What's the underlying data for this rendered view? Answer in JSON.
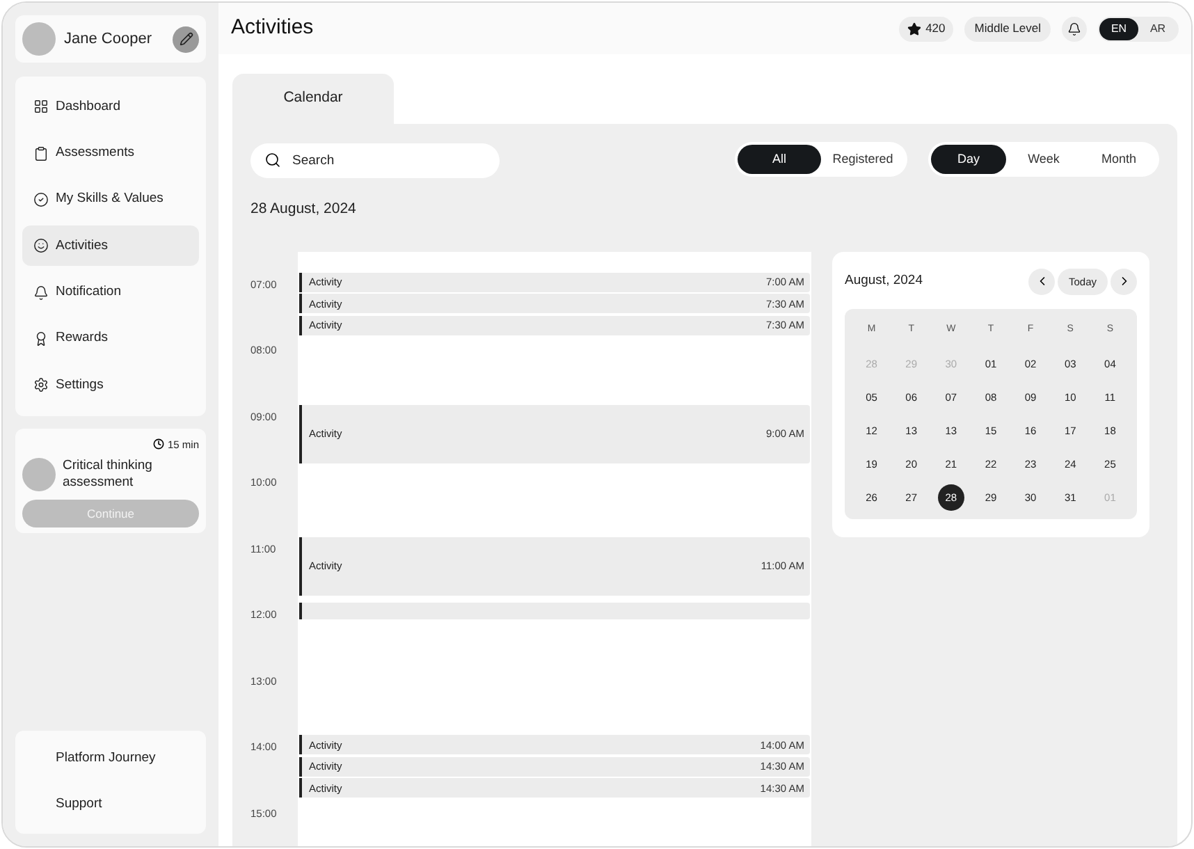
{
  "user": {
    "name": "Jane Cooper"
  },
  "nav": [
    {
      "label": "Dashboard",
      "selected": false
    },
    {
      "label": "Assessments",
      "selected": false
    },
    {
      "label": "My Skills & Values",
      "selected": false
    },
    {
      "label": "Activities",
      "selected": true
    },
    {
      "label": "Notification",
      "selected": false
    },
    {
      "label": "Rewards",
      "selected": false
    },
    {
      "label": "Settings",
      "selected": false
    }
  ],
  "assessment_card": {
    "duration": "15 min",
    "title": "Critical thinking assessment",
    "button": "Continue",
    "disabled": true
  },
  "bottom_links": [
    "Platform Journey",
    "Support"
  ],
  "header": {
    "title": "Activities",
    "points": "420",
    "level": "Middle Level",
    "languages": [
      {
        "label": "EN",
        "selected": true
      },
      {
        "label": "AR",
        "selected": false
      }
    ]
  },
  "tabs": [
    {
      "label": "Calendar",
      "selected": true
    }
  ],
  "search": {
    "placeholder": "Search"
  },
  "filters": [
    {
      "label": "All",
      "selected": true
    },
    {
      "label": "Registered",
      "selected": false
    }
  ],
  "views": [
    {
      "label": "Day",
      "selected": true
    },
    {
      "label": "Week",
      "selected": false
    },
    {
      "label": "Month",
      "selected": false
    }
  ],
  "date": "28 August, 2024",
  "timeline": [
    {
      "hour": "07:00",
      "events": [
        {
          "kind": "short",
          "label": "Activity",
          "time": "7:00 AM"
        },
        {
          "kind": "short",
          "label": "Activity",
          "time": "7:30 AM"
        },
        {
          "kind": "short",
          "label": "Activity",
          "time": "7:30 AM"
        }
      ]
    },
    {
      "hour": "08:00"
    },
    {
      "hour": "09:00",
      "events": [
        {
          "kind": "long",
          "label": "Activity",
          "time": "9:00 AM"
        }
      ]
    },
    {
      "hour": "10:00"
    },
    {
      "hour": "11:00",
      "events": [
        {
          "kind": "long",
          "label": "Activity",
          "time": "11:00 AM"
        }
      ]
    },
    {
      "hour": "12:00",
      "events": [
        {
          "kind": "bar"
        }
      ]
    },
    {
      "hour": "13:00"
    },
    {
      "hour": "14:00",
      "events": [
        {
          "kind": "short",
          "label": "Activity",
          "time": "14:00 AM"
        },
        {
          "kind": "short",
          "label": "Activity",
          "time": "14:30 AM"
        },
        {
          "kind": "short",
          "label": "Activity",
          "time": "14:30 AM"
        }
      ]
    },
    {
      "hour": "15:00"
    }
  ],
  "mini_calendar": {
    "title": "August, 2024",
    "today": "Today",
    "weekdays": [
      "M",
      "T",
      "W",
      "T",
      "F",
      "S",
      "S"
    ],
    "days": [
      {
        "label": "28",
        "outside": true,
        "selected": false
      },
      {
        "label": "29",
        "outside": true,
        "selected": false
      },
      {
        "label": "30",
        "outside": true,
        "selected": false
      },
      {
        "label": "01",
        "outside": false,
        "selected": false
      },
      {
        "label": "02",
        "outside": false,
        "selected": false
      },
      {
        "label": "03",
        "outside": false,
        "selected": false
      },
      {
        "label": "04",
        "outside": false,
        "selected": false
      },
      {
        "label": "05",
        "outside": false,
        "selected": false
      },
      {
        "label": "06",
        "outside": false,
        "selected": false
      },
      {
        "label": "07",
        "outside": false,
        "selected": false
      },
      {
        "label": "08",
        "outside": false,
        "selected": false
      },
      {
        "label": "09",
        "outside": false,
        "selected": false
      },
      {
        "label": "10",
        "outside": false,
        "selected": false
      },
      {
        "label": "11",
        "outside": false,
        "selected": false
      },
      {
        "label": "12",
        "outside": false,
        "selected": false
      },
      {
        "label": "13",
        "outside": false,
        "selected": false
      },
      {
        "label": "13",
        "outside": false,
        "selected": false
      },
      {
        "label": "15",
        "outside": false,
        "selected": false
      },
      {
        "label": "16",
        "outside": false,
        "selected": false
      },
      {
        "label": "17",
        "outside": false,
        "selected": false
      },
      {
        "label": "18",
        "outside": false,
        "selected": false
      },
      {
        "label": "19",
        "outside": false,
        "selected": false
      },
      {
        "label": "20",
        "outside": false,
        "selected": false
      },
      {
        "label": "21",
        "outside": false,
        "selected": false
      },
      {
        "label": "22",
        "outside": false,
        "selected": false
      },
      {
        "label": "23",
        "outside": false,
        "selected": false
      },
      {
        "label": "24",
        "outside": false,
        "selected": false
      },
      {
        "label": "25",
        "outside": false,
        "selected": false
      },
      {
        "label": "26",
        "outside": false,
        "selected": false
      },
      {
        "label": "27",
        "outside": false,
        "selected": false
      },
      {
        "label": "28",
        "outside": false,
        "selected": true
      },
      {
        "label": "29",
        "outside": false,
        "selected": false
      },
      {
        "label": "30",
        "outside": false,
        "selected": false
      },
      {
        "label": "31",
        "outside": false,
        "selected": false
      },
      {
        "label": "01",
        "outside": true,
        "selected": false
      }
    ]
  }
}
